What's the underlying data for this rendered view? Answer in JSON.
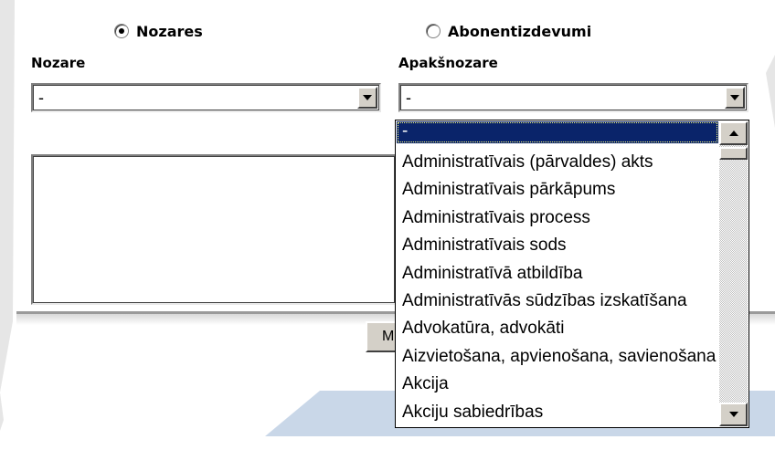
{
  "radios": {
    "nozares_label": "Nozares",
    "abonent_label": "Abonentizdevumi",
    "selected": "Nozares"
  },
  "fields": {
    "nozare_label": "Nozare",
    "apaksnozare_label": "Apakšnozare"
  },
  "selects": {
    "nozare_value": "-",
    "apaksnozare_value": "-"
  },
  "button": {
    "label": "M"
  },
  "dropdown": {
    "items": [
      "-",
      "Administratīvais (pārvaldes) akts",
      "Administratīvais pārkāpums",
      "Administratīvais process",
      "Administratīvais sods",
      "Administratīvā atbildība",
      "Administratīvās sūdzības izskatīšana",
      "Advokatūra, advokāti",
      "Aizvietošana, apvienošana, savienošana",
      "Akcija",
      "Akciju sabiedrības"
    ],
    "selected_index": 0
  },
  "colors": {
    "selection": "#0a246a",
    "face": "#d4d0c8",
    "band": "#c9d7e8"
  }
}
